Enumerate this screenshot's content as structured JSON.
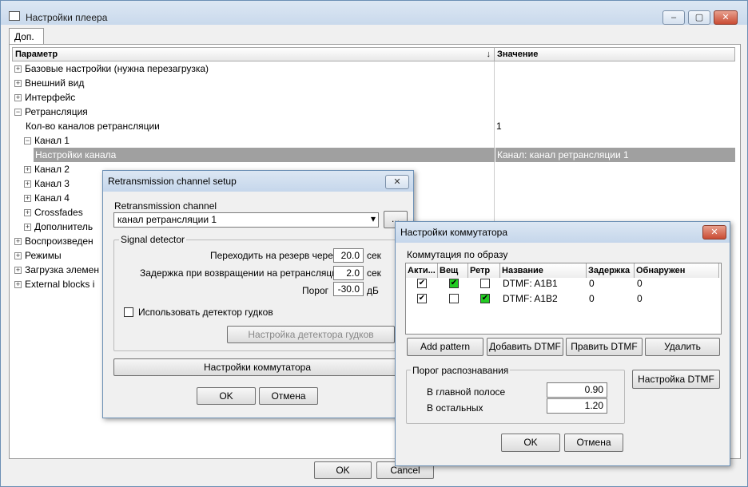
{
  "main": {
    "title": "Настройки плеера",
    "tab": "Доп.",
    "col_param": "Параметр",
    "col_value": "Значение",
    "tree": [
      "Базовые настройки (нужна перезагрузка)",
      "Внешний вид",
      "Интерфейс",
      "Ретрансляция",
      "Кол-во каналов ретрансляции",
      "Канал 1",
      "Настройки канала",
      "Канал 2",
      "Канал 3",
      "Канал 4",
      "Crossfades",
      "Дополнитель",
      "Воспроизведен",
      "Режимы",
      "Загрузка элемен",
      "External blocks i"
    ],
    "val_channels": "1",
    "val_selected": "Канал:  канал ретрансляции 1",
    "ok": "OK",
    "cancel": "Cancel"
  },
  "retrans": {
    "title": "Retransmission channel setup",
    "channel_label": "Retransmission channel",
    "channel_value": "канал ретрансляции 1",
    "browse": "...",
    "detector": "Signal detector",
    "switch_label": "Переходить на резерв через",
    "switch_val": "20.0",
    "switch_unit": "сек",
    "delay_label": "Задержка при возвращении на ретрансляцию",
    "delay_val": "2.0",
    "delay_unit": "сек",
    "thresh_label": "Порог",
    "thresh_val": "-30.0",
    "thresh_unit": "дБ",
    "use_beep": "Использовать детектор гудков",
    "beep_settings": "Настройка детектора гудков",
    "switch_settings": "Настройки коммутатора",
    "ok": "OK",
    "cancel": "Отмена"
  },
  "commut": {
    "title": "Настройки коммутатора",
    "section": "Коммутация по образу",
    "cols": [
      "Акти...",
      "Вещ",
      "Ретр",
      "Название",
      "Задержка",
      "Обнаружен"
    ],
    "rows": [
      {
        "name": "DTMF: A1B1",
        "delay": "0",
        "found": "0"
      },
      {
        "name": "DTMF: A1B2",
        "delay": "0",
        "found": "0"
      }
    ],
    "add_pattern": "Add pattern",
    "add_dtmf": "Добавить DTMF",
    "edit_dtmf": "Править DTMF",
    "delete": "Удалить",
    "threshold": "Порог распознавания",
    "main_band": "В главной полосе",
    "main_val": "0.90",
    "others": "В остальных",
    "others_val": "1.20",
    "dtmf_setup": "Настройка DTMF",
    "ok": "OK",
    "cancel": "Отмена"
  }
}
